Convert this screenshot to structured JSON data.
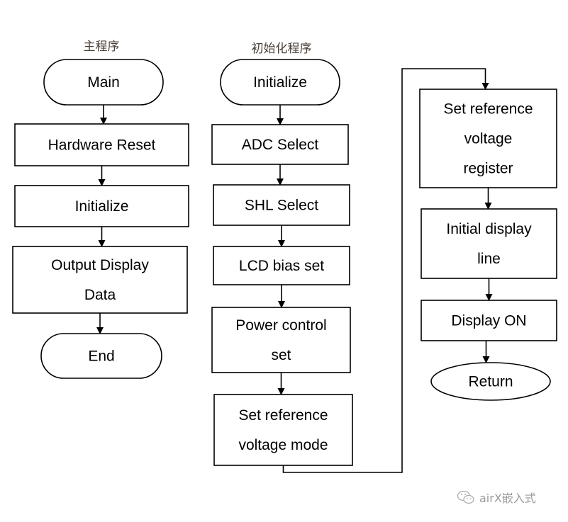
{
  "titles": {
    "main": "主程序",
    "init": "初始化程序"
  },
  "nodes": [
    {
      "id": "main-start",
      "shape": "terminal",
      "lines": [
        "Main"
      ]
    },
    {
      "id": "hardware-reset",
      "shape": "process",
      "lines": [
        "Hardware Reset"
      ]
    },
    {
      "id": "main-initialize",
      "shape": "process",
      "lines": [
        "Initialize"
      ]
    },
    {
      "id": "output-display-data",
      "shape": "process",
      "lines": [
        "Output Display",
        "Data"
      ]
    },
    {
      "id": "main-end",
      "shape": "terminal",
      "lines": [
        "End"
      ]
    },
    {
      "id": "init-start",
      "shape": "terminal",
      "lines": [
        "Initialize"
      ]
    },
    {
      "id": "adc-select",
      "shape": "process",
      "lines": [
        "ADC Select"
      ]
    },
    {
      "id": "shl-select",
      "shape": "process",
      "lines": [
        "SHL Select"
      ]
    },
    {
      "id": "lcd-bias-set",
      "shape": "process",
      "lines": [
        "LCD bias set"
      ]
    },
    {
      "id": "power-control-set",
      "shape": "process",
      "lines": [
        "Power control",
        "set"
      ]
    },
    {
      "id": "set-reference-voltage-mode",
      "shape": "process",
      "lines": [
        "Set reference",
        "voltage mode"
      ]
    },
    {
      "id": "set-reference-voltage-register",
      "shape": "process",
      "lines": [
        "Set reference",
        "voltage",
        "register"
      ]
    },
    {
      "id": "initial-display-line",
      "shape": "process",
      "lines": [
        "Initial display",
        "line"
      ]
    },
    {
      "id": "display-on",
      "shape": "process",
      "lines": [
        "Display ON"
      ]
    },
    {
      "id": "return",
      "shape": "ellipse",
      "lines": [
        "Return"
      ]
    }
  ],
  "edges": [
    [
      "main-start",
      "hardware-reset"
    ],
    [
      "hardware-reset",
      "main-initialize"
    ],
    [
      "main-initialize",
      "output-display-data"
    ],
    [
      "output-display-data",
      "main-end"
    ],
    [
      "init-start",
      "adc-select"
    ],
    [
      "adc-select",
      "shl-select"
    ],
    [
      "shl-select",
      "lcd-bias-set"
    ],
    [
      "lcd-bias-set",
      "power-control-set"
    ],
    [
      "power-control-set",
      "set-reference-voltage-mode"
    ],
    [
      "set-reference-voltage-mode",
      "set-reference-voltage-register"
    ],
    [
      "set-reference-voltage-register",
      "initial-display-line"
    ],
    [
      "initial-display-line",
      "display-on"
    ],
    [
      "display-on",
      "return"
    ]
  ],
  "watermark": {
    "icon": "wechat-icon",
    "text": "airX嵌入式"
  }
}
